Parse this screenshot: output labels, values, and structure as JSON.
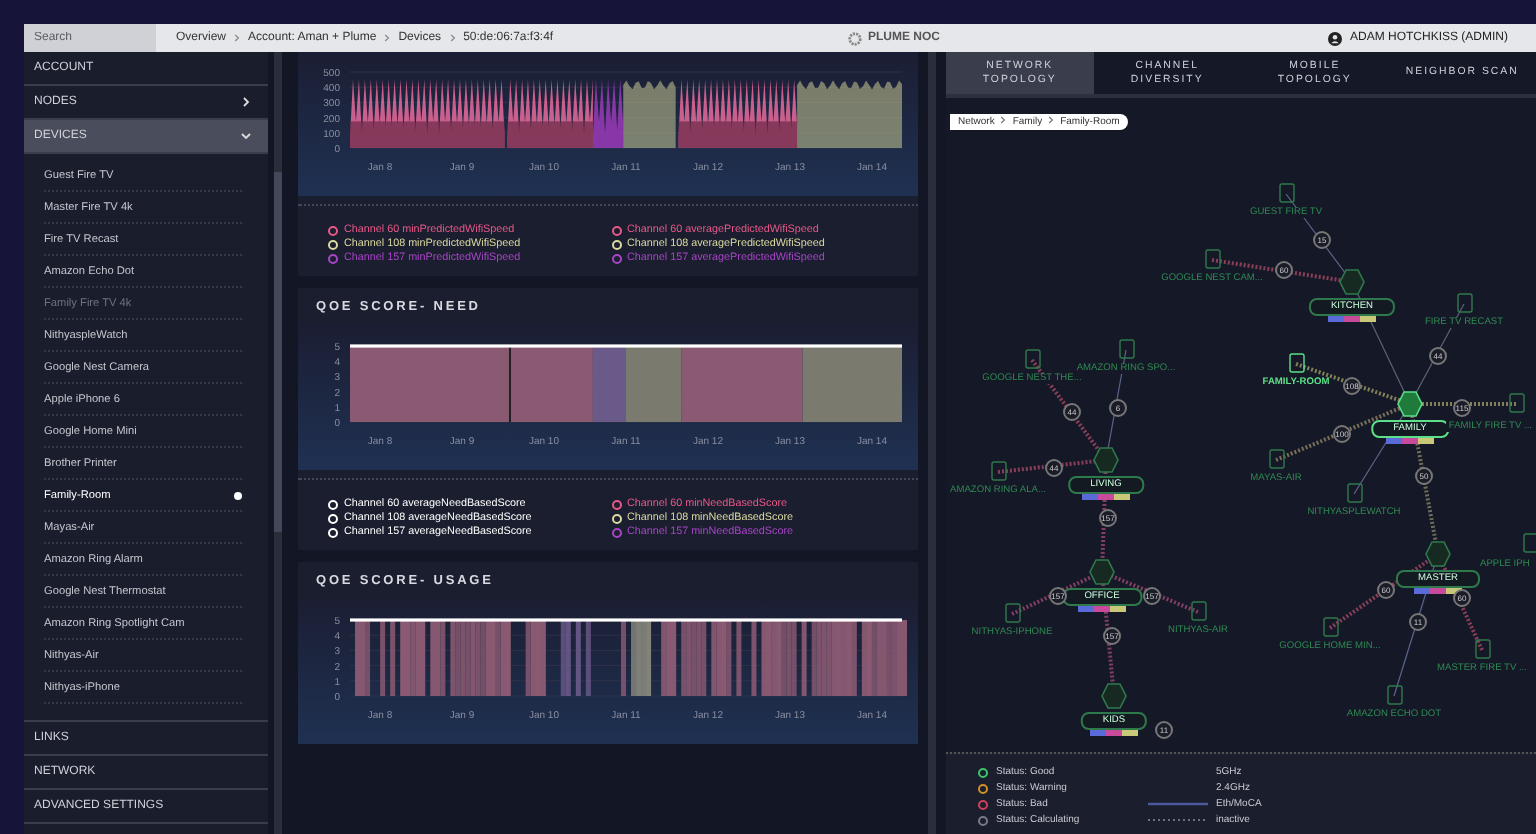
{
  "topbar": {
    "search": {
      "placeholder": "Search"
    },
    "breadcrumb": [
      "Overview",
      "Account: Aman + Plume",
      "Devices",
      "50:de:06:7a:f3:4f"
    ],
    "brand": "PLUME NOC",
    "user": "ADAM HOTCHKISS (ADMIN)"
  },
  "sidebar": {
    "sections": [
      {
        "label": "ACCOUNT",
        "kind": "link"
      },
      {
        "label": "NODES",
        "kind": "group",
        "expanded": false,
        "selected": false
      },
      {
        "label": "DEVICES",
        "kind": "group",
        "expanded": true,
        "selected": true,
        "items": [
          {
            "label": "Guest Fire TV",
            "selected": false,
            "dimmed": false
          },
          {
            "label": "Master Fire TV 4k",
            "selected": false,
            "dimmed": false
          },
          {
            "label": "Fire TV Recast",
            "selected": false,
            "dimmed": false
          },
          {
            "label": "Amazon Echo Dot",
            "selected": false,
            "dimmed": false
          },
          {
            "label": "Family Fire TV 4k",
            "selected": false,
            "dimmed": true
          },
          {
            "label": "NithyaspleWatch",
            "selected": false,
            "dimmed": false
          },
          {
            "label": "Google Nest Camera",
            "selected": false,
            "dimmed": false
          },
          {
            "label": "Apple iPhone 6",
            "selected": false,
            "dimmed": false
          },
          {
            "label": "Google Home Mini",
            "selected": false,
            "dimmed": false
          },
          {
            "label": "Brother Printer",
            "selected": false,
            "dimmed": false
          },
          {
            "label": "Family-Room",
            "selected": true,
            "dimmed": false
          },
          {
            "label": "Mayas-Air",
            "selected": false,
            "dimmed": false
          },
          {
            "label": "Amazon Ring Alarm",
            "selected": false,
            "dimmed": false
          },
          {
            "label": "Google Nest Thermostat",
            "selected": false,
            "dimmed": false
          },
          {
            "label": "Amazon Ring Spotlight Cam",
            "selected": false,
            "dimmed": false
          },
          {
            "label": "Nithyas-Air",
            "selected": false,
            "dimmed": false
          },
          {
            "label": "Nithyas-iPhone",
            "selected": false,
            "dimmed": false
          }
        ]
      },
      {
        "label": "LINKS",
        "kind": "link"
      },
      {
        "label": "NETWORK",
        "kind": "link"
      },
      {
        "label": "ADVANCED SETTINGS",
        "kind": "link"
      }
    ]
  },
  "panels": [
    {
      "kind": "speed",
      "yticks": [
        "500",
        "400",
        "300",
        "200",
        "100",
        "0"
      ],
      "xlabels": [
        "Jan 8",
        "Jan 9",
        "Jan 10",
        "Jan 11",
        "Jan 12",
        "Jan 13",
        "Jan 14"
      ],
      "legend": [
        {
          "label": "Channel 60 minPredictedWifiSpeed",
          "color": "#e8588a"
        },
        {
          "label": "Channel 60 averagePredictedWifiSpeed",
          "color": "#e8588a"
        },
        {
          "label": "Channel 108 minPredictedWifiSpeed",
          "color": "#d9d9a0"
        },
        {
          "label": "Channel 108 averagePredictedWifiSpeed",
          "color": "#d9d9a0"
        },
        {
          "label": "Channel 157 minPredictedWifiSpeed",
          "color": "#a844c8"
        },
        {
          "label": "Channel 157 averagePredictedWifiSpeed",
          "color": "#a844c8"
        }
      ]
    },
    {
      "kind": "need",
      "title": "QOE SCORE- NEED",
      "yticks": [
        "5",
        "4",
        "3",
        "2",
        "1",
        "0"
      ],
      "xlabels": [
        "Jan 8",
        "Jan 9",
        "Jan 10",
        "Jan 11",
        "Jan 12",
        "Jan 13",
        "Jan 14"
      ],
      "legend": [
        {
          "label": "Channel 60 averageNeedBasedScore",
          "color": "#ffffff"
        },
        {
          "label": "Channel 60 minNeedBasedScore",
          "color": "#e8588a"
        },
        {
          "label": "Channel 108 averageNeedBasedScore",
          "color": "#ffffff"
        },
        {
          "label": "Channel 108 minNeedBasedScore",
          "color": "#d9d9a0"
        },
        {
          "label": "Channel 157 averageNeedBasedScore",
          "color": "#ffffff"
        },
        {
          "label": "Channel 157 minNeedBasedScore",
          "color": "#a844c8"
        }
      ]
    },
    {
      "kind": "usage",
      "title": "QOE SCORE- USAGE",
      "yticks": [
        "5",
        "4",
        "3",
        "2",
        "1",
        "0"
      ],
      "xlabels": [
        "Jan 8",
        "Jan 9",
        "Jan 10",
        "Jan 11",
        "Jan 12",
        "Jan 13",
        "Jan 14"
      ]
    }
  ],
  "topology": {
    "tabs": [
      {
        "label": [
          "NETWORK",
          "TOPOLOGY"
        ],
        "selected": true
      },
      {
        "label": [
          "CHANNEL",
          "DIVERSITY"
        ],
        "selected": false
      },
      {
        "label": [
          "MOBILE",
          "TOPOLOGY"
        ],
        "selected": false
      },
      {
        "label": [
          "NEIGHBOR SCAN"
        ],
        "selected": false
      }
    ],
    "breadcrumb": [
      "Network",
      "Family",
      "Family-Room"
    ],
    "nodes": [
      {
        "kind": "device",
        "label": "GUEST FIRE TV",
        "highlighted": false
      },
      {
        "kind": "device",
        "label": "GOOGLE NEST CAM...",
        "highlighted": false
      },
      {
        "kind": "pod",
        "label": "KITCHEN",
        "highlighted": false
      },
      {
        "kind": "device",
        "label": "FIRE TV RECAST",
        "highlighted": false
      },
      {
        "kind": "device",
        "label": "GOOGLE NEST THE...",
        "highlighted": false
      },
      {
        "kind": "device",
        "label": "AMAZON RING SPO...",
        "highlighted": false
      },
      {
        "kind": "device",
        "label": "FAMILY-ROOM",
        "highlighted": true
      },
      {
        "kind": "pod",
        "label": "FAMILY",
        "highlighted": true
      },
      {
        "kind": "device",
        "label": "FAMILY FIRE TV ...",
        "highlighted": false
      },
      {
        "kind": "device",
        "label": "MAYAS-AIR",
        "highlighted": false
      },
      {
        "kind": "pod",
        "label": "LIVING",
        "highlighted": false
      },
      {
        "kind": "device",
        "label": "AMAZON RING ALA...",
        "highlighted": false
      },
      {
        "kind": "device",
        "label": "NITHYASPLEWATCH",
        "highlighted": false
      },
      {
        "kind": "pod",
        "label": "OFFICE",
        "highlighted": false
      },
      {
        "kind": "pod",
        "label": "MASTER",
        "highlighted": false
      },
      {
        "kind": "device",
        "label": "APPLE IPH",
        "highlighted": false
      },
      {
        "kind": "device",
        "label": "NITHYAS-IPHONE",
        "highlighted": false
      },
      {
        "kind": "device",
        "label": "NITHYAS-AIR",
        "highlighted": false
      },
      {
        "kind": "device",
        "label": "GOOGLE HOME MIN...",
        "highlighted": false
      },
      {
        "kind": "device",
        "label": "MASTER FIRE TV ...",
        "highlighted": false
      },
      {
        "kind": "pod",
        "label": "KIDS",
        "highlighted": false
      },
      {
        "kind": "device",
        "label": "AMAZON ECHO DOT",
        "highlighted": false
      }
    ],
    "channels": [
      "15",
      "60",
      "108",
      "44",
      "115",
      "100",
      "50",
      "44",
      "6",
      "44",
      "157",
      "157",
      "157",
      "157",
      "60",
      "60",
      "11",
      "11"
    ],
    "legend": {
      "statuses": [
        {
          "label": "Status: Good",
          "color": "#3ec46d"
        },
        {
          "label": "Status: Warning",
          "color": "#d0902a"
        },
        {
          "label": "Status: Bad",
          "color": "#d04058"
        },
        {
          "label": "Status: Calculating",
          "color": "#7a7a86"
        }
      ],
      "links": [
        {
          "label": "5GHz",
          "kind": "wifi5"
        },
        {
          "label": "2.4GHz",
          "kind": "wifi24"
        },
        {
          "label": "Eth/MoCA",
          "kind": "eth"
        },
        {
          "label": "inactive",
          "kind": "inactive"
        }
      ]
    }
  }
}
